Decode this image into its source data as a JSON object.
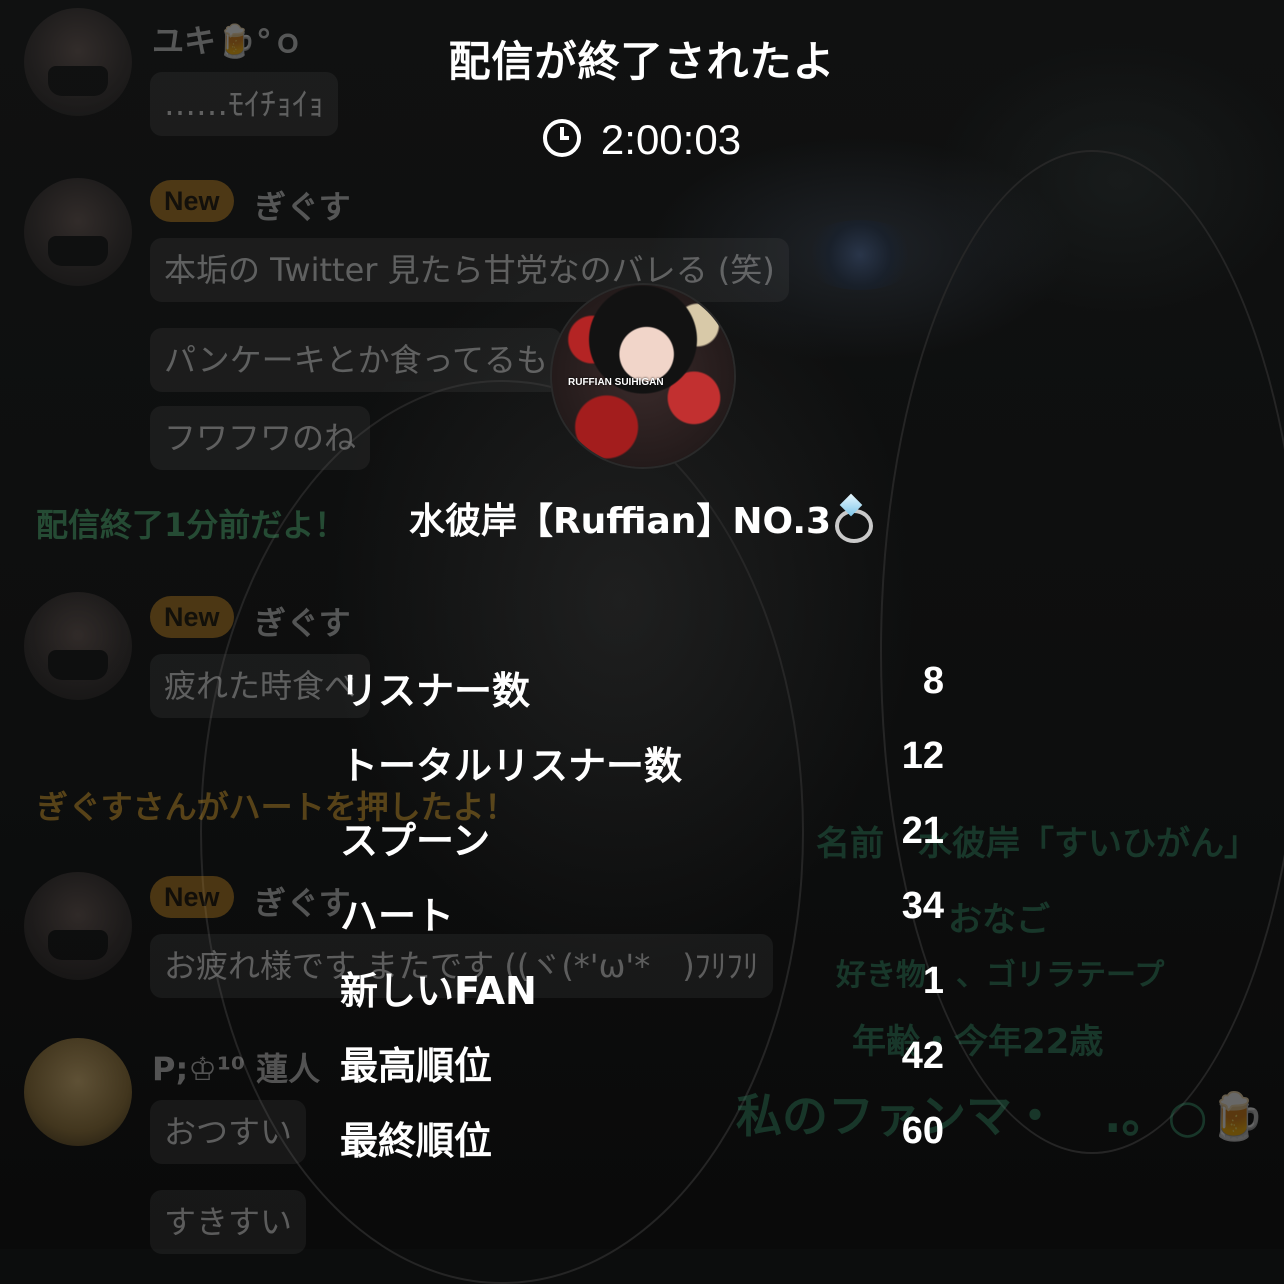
{
  "overlay": {
    "title": "配信が終了されたよ",
    "duration": "2:00:03",
    "host_name": "水彼岸【Ruffian】NO.3",
    "host_avatar_text": "RUFFIAN SUIHIGAN",
    "stats": [
      {
        "label": "リスナー数",
        "value": "8"
      },
      {
        "label": "トータルリスナー数",
        "value": "12"
      },
      {
        "label": "スプーン",
        "value": "21"
      },
      {
        "label": "ハート",
        "value": "34"
      },
      {
        "label": "新しいFAN",
        "value": "1"
      },
      {
        "label": "最高順位",
        "value": "42"
      },
      {
        "label": "最終順位",
        "value": "60"
      }
    ]
  },
  "chat": {
    "new_badge": "New",
    "messages": [
      {
        "user": "ユキ🍺°ｏ",
        "text": "……ﾓｲﾁｮｲｮ"
      },
      {
        "user": "ぎぐす",
        "texts": [
          "本垢の Twitter 見たら甘党なのバレる (笑)",
          "パンケーキとか食ってるも",
          "フワフワのね"
        ]
      },
      {
        "user": "ぎぐす",
        "text": "疲れた時食べ"
      },
      {
        "user": "ぎぐす",
        "text": "お疲れ様です またです ((ヾ(*'ω'*　)ﾌﾘﾌﾘ"
      },
      {
        "user": "P;♔¹⁰ 蓮人",
        "text": "おつすい"
      },
      {
        "text": "すきすい"
      }
    ],
    "system_end_warning": "配信終了1分前だよ！",
    "system_heart": "ぎぐすさんがハートを押したよ！"
  },
  "background_profile": {
    "line1": "名前　水彼岸「すいひがん」",
    "line2": "おなご",
    "line3": "好き物　、ゴリラテープ",
    "line4": "年齢・今年22歳",
    "line5": "私のファンマ・　.。○🍺"
  },
  "colors": {
    "background": "#0c0d0d",
    "new_badge": "#b27a1e",
    "system_green": "#4cae71",
    "system_gold": "#d09a2a"
  }
}
